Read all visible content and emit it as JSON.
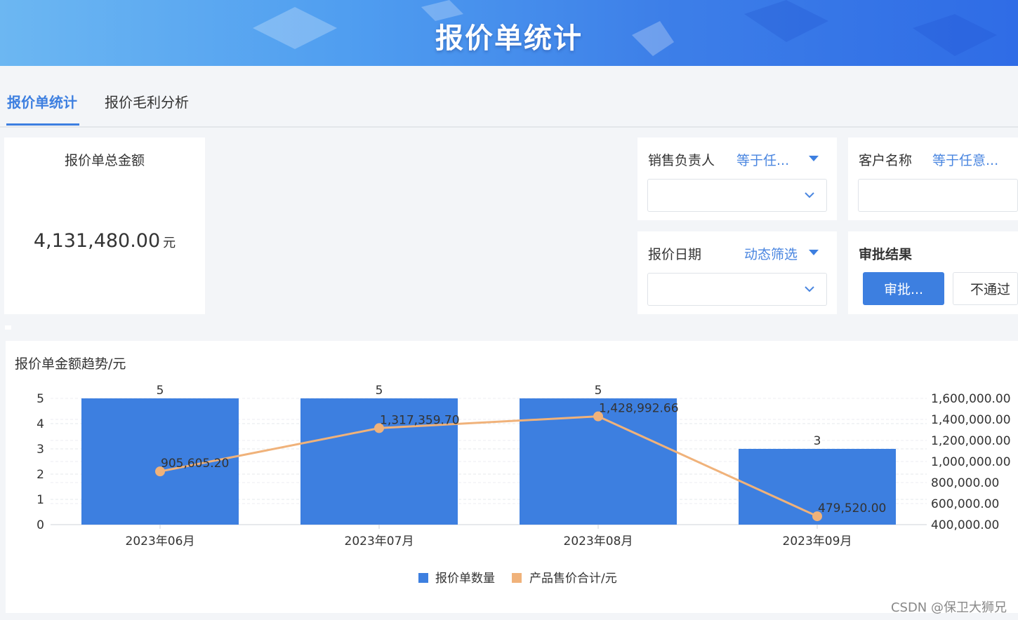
{
  "header": {
    "title": "报价单统计"
  },
  "tabs": [
    {
      "label": "报价单统计",
      "active": true
    },
    {
      "label": "报价毛利分析",
      "active": false
    }
  ],
  "kpi": {
    "title": "报价单总金额",
    "value": "4,131,480.00",
    "unit": "元"
  },
  "filters": {
    "sales_owner": {
      "label": "销售负责人",
      "mode": "等于任...",
      "value": ""
    },
    "customer_name": {
      "label": "客户名称",
      "mode": "等于任意...",
      "value": ""
    },
    "quote_date": {
      "label": "报价日期",
      "mode": "动态筛选",
      "value": ""
    },
    "approval_result": {
      "label": "审批结果",
      "options": [
        "审批...",
        "不通过"
      ],
      "selected": "审批..."
    }
  },
  "chart_data": {
    "type": "bar",
    "title": "报价单金额趋势/元",
    "categories": [
      "2023年06月",
      "2023年07月",
      "2023年08月",
      "2023年09月"
    ],
    "series": [
      {
        "name": "报价单数量",
        "type": "bar",
        "axis": "left",
        "color": "#3d7fe0",
        "values": [
          5,
          5,
          5,
          3
        ],
        "labels": [
          "5",
          "5",
          "5",
          "3"
        ]
      },
      {
        "name": "产品售价合计/元",
        "type": "line",
        "axis": "right",
        "color": "#f0b27a",
        "values": [
          905605.2,
          1317359.7,
          1428992.66,
          479520.0
        ],
        "labels": [
          "905,605.20",
          "1,317,359.70",
          "1,428,992.66",
          "479,520.00"
        ]
      }
    ],
    "y_left": {
      "ticks": [
        "0",
        "1",
        "2",
        "3",
        "4",
        "5"
      ],
      "range": [
        0,
        5
      ]
    },
    "y_right": {
      "ticks": [
        "400,000.00",
        "600,000.00",
        "800,000.00",
        "1,000,000.00",
        "1,200,000.00",
        "1,400,000.00",
        "1,600,000.00"
      ],
      "range": [
        400000,
        1600000
      ]
    },
    "grid": true,
    "legend": "bottom-center"
  },
  "watermark": "CSDN @保卫大狮兄"
}
